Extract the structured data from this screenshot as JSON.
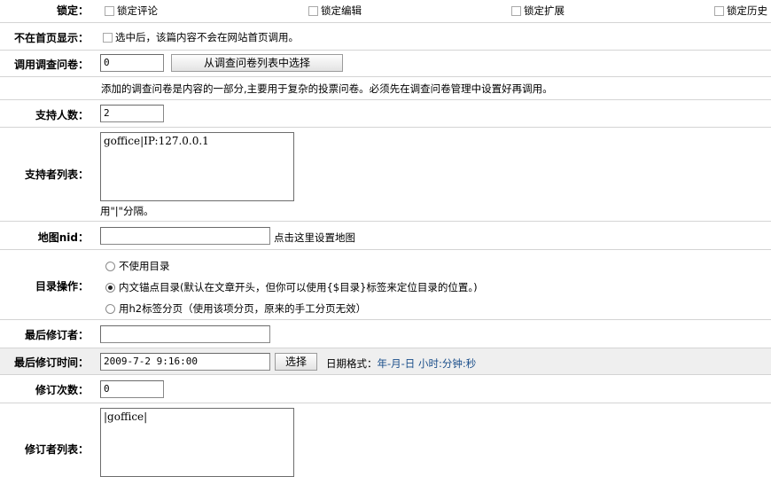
{
  "lock": {
    "label": "锁定：",
    "options": [
      "锁定评论",
      "锁定编辑",
      "锁定扩展",
      "锁定历史"
    ]
  },
  "not_homepage": {
    "label": "不在首页显示：",
    "checkbox_text": "选中后，该篇内容不会在网站首页调用。"
  },
  "poll": {
    "label": "调用调查问卷：",
    "value": "0",
    "select_button": "从调查问卷列表中选择",
    "help": "添加的调查问卷是内容的一部分,主要用于复杂的投票问卷。必须先在调查问卷管理中设置好再调用。"
  },
  "supporters_count": {
    "label": "支持人数：",
    "value": "2"
  },
  "supporters_list": {
    "label": "支持者列表：",
    "value": "goffice|IP:127.0.0.1",
    "hint": "用\"|\"分隔。"
  },
  "map": {
    "label": "地图nid：",
    "value": "",
    "link": "点击这里设置地图"
  },
  "toc": {
    "label": "目录操作：",
    "options": [
      "不使用目录",
      "内文锚点目录(默认在文章开头，但你可以使用{$目录}标签来定位目录的位置。)",
      "用h2标签分页（使用该项分页，原来的手工分页无效）"
    ],
    "selected_index": 1
  },
  "last_reviser": {
    "label": "最后修订者：",
    "value": ""
  },
  "last_revised_time": {
    "label": "最后修订时间：",
    "value": "2009-7-2 9:16:00",
    "select_button": "选择",
    "format_label": "日期格式：",
    "format_value": "年-月-日 小时:分钟:秒"
  },
  "revision_count": {
    "label": "修订次数：",
    "value": "0"
  },
  "revisers_list": {
    "label": "修订者列表：",
    "value": "|goffice|"
  },
  "colors": {
    "row_border": "#d4d4d4",
    "highlight_row": "#efefef",
    "link_blue": "#1a4e8a"
  }
}
